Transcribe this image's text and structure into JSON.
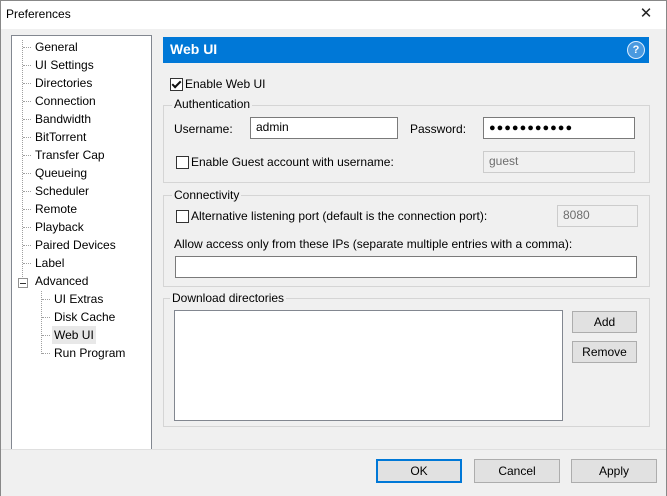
{
  "window": {
    "title": "Preferences",
    "close_symbol": "✕"
  },
  "tree": {
    "items": [
      {
        "label": "General"
      },
      {
        "label": "UI Settings"
      },
      {
        "label": "Directories"
      },
      {
        "label": "Connection"
      },
      {
        "label": "Bandwidth"
      },
      {
        "label": "BitTorrent"
      },
      {
        "label": "Transfer Cap"
      },
      {
        "label": "Queueing"
      },
      {
        "label": "Scheduler"
      },
      {
        "label": "Remote"
      },
      {
        "label": "Playback"
      },
      {
        "label": "Paired Devices"
      },
      {
        "label": "Label"
      },
      {
        "label": "Advanced"
      },
      {
        "label": "UI Extras"
      },
      {
        "label": "Disk Cache"
      },
      {
        "label": "Web UI",
        "selected": true
      },
      {
        "label": "Run Program"
      }
    ]
  },
  "header": {
    "title": "Web UI",
    "help": "?",
    "color": "#0078d7"
  },
  "enable_webui": {
    "label": "Enable Web UI",
    "checked": true
  },
  "authentication": {
    "title": "Authentication",
    "username_label": "Username:",
    "username_value": "admin",
    "password_label": "Password:",
    "password_value": "●●●●●●●●●●●",
    "guest_label": "Enable Guest account with username:",
    "guest_checked": false,
    "guest_value": "guest"
  },
  "connectivity": {
    "title": "Connectivity",
    "alt_port_label": "Alternative listening port (default is the connection port):",
    "alt_port_checked": false,
    "alt_port_value": "8080",
    "allow_ips_label": "Allow access only from these IPs (separate multiple entries with a comma):",
    "allow_ips_value": ""
  },
  "download_dirs": {
    "title": "Download directories",
    "add": "Add",
    "remove": "Remove"
  },
  "footer": {
    "ok": "OK",
    "cancel": "Cancel",
    "apply": "Apply"
  }
}
